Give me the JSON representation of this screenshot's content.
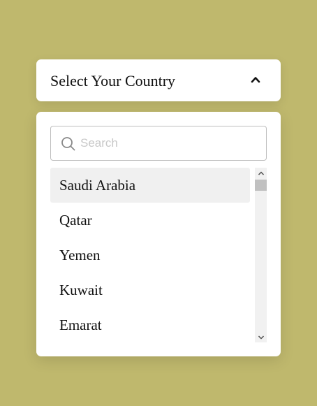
{
  "select": {
    "title": "Select Your Country",
    "expanded": true,
    "chevron_icon": "chevron-up-icon"
  },
  "search": {
    "placeholder": "Search",
    "value": "",
    "icon": "search-icon"
  },
  "countries": [
    {
      "label": "Saudi Arabia",
      "selected": true
    },
    {
      "label": "Qatar",
      "selected": false
    },
    {
      "label": "Yemen",
      "selected": false
    },
    {
      "label": "Kuwait",
      "selected": false
    },
    {
      "label": "Emarat",
      "selected": false
    }
  ],
  "colors": {
    "background": "#bfb86d",
    "panel": "#ffffff",
    "selected_row": "#f0f0f0",
    "text": "#111111",
    "placeholder": "#c8c8c8"
  }
}
